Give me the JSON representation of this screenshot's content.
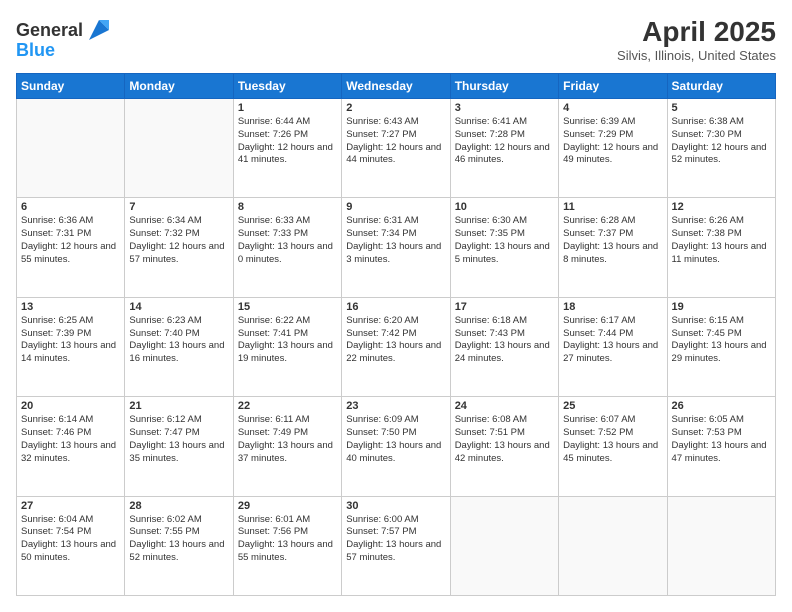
{
  "logo": {
    "line1": "General",
    "line2": "Blue"
  },
  "title": "April 2025",
  "location": "Silvis, Illinois, United States",
  "weekdays": [
    "Sunday",
    "Monday",
    "Tuesday",
    "Wednesday",
    "Thursday",
    "Friday",
    "Saturday"
  ],
  "weeks": [
    [
      {
        "day": "",
        "detail": ""
      },
      {
        "day": "",
        "detail": ""
      },
      {
        "day": "1",
        "detail": "Sunrise: 6:44 AM\nSunset: 7:26 PM\nDaylight: 12 hours and 41 minutes."
      },
      {
        "day": "2",
        "detail": "Sunrise: 6:43 AM\nSunset: 7:27 PM\nDaylight: 12 hours and 44 minutes."
      },
      {
        "day": "3",
        "detail": "Sunrise: 6:41 AM\nSunset: 7:28 PM\nDaylight: 12 hours and 46 minutes."
      },
      {
        "day": "4",
        "detail": "Sunrise: 6:39 AM\nSunset: 7:29 PM\nDaylight: 12 hours and 49 minutes."
      },
      {
        "day": "5",
        "detail": "Sunrise: 6:38 AM\nSunset: 7:30 PM\nDaylight: 12 hours and 52 minutes."
      }
    ],
    [
      {
        "day": "6",
        "detail": "Sunrise: 6:36 AM\nSunset: 7:31 PM\nDaylight: 12 hours and 55 minutes."
      },
      {
        "day": "7",
        "detail": "Sunrise: 6:34 AM\nSunset: 7:32 PM\nDaylight: 12 hours and 57 minutes."
      },
      {
        "day": "8",
        "detail": "Sunrise: 6:33 AM\nSunset: 7:33 PM\nDaylight: 13 hours and 0 minutes."
      },
      {
        "day": "9",
        "detail": "Sunrise: 6:31 AM\nSunset: 7:34 PM\nDaylight: 13 hours and 3 minutes."
      },
      {
        "day": "10",
        "detail": "Sunrise: 6:30 AM\nSunset: 7:35 PM\nDaylight: 13 hours and 5 minutes."
      },
      {
        "day": "11",
        "detail": "Sunrise: 6:28 AM\nSunset: 7:37 PM\nDaylight: 13 hours and 8 minutes."
      },
      {
        "day": "12",
        "detail": "Sunrise: 6:26 AM\nSunset: 7:38 PM\nDaylight: 13 hours and 11 minutes."
      }
    ],
    [
      {
        "day": "13",
        "detail": "Sunrise: 6:25 AM\nSunset: 7:39 PM\nDaylight: 13 hours and 14 minutes."
      },
      {
        "day": "14",
        "detail": "Sunrise: 6:23 AM\nSunset: 7:40 PM\nDaylight: 13 hours and 16 minutes."
      },
      {
        "day": "15",
        "detail": "Sunrise: 6:22 AM\nSunset: 7:41 PM\nDaylight: 13 hours and 19 minutes."
      },
      {
        "day": "16",
        "detail": "Sunrise: 6:20 AM\nSunset: 7:42 PM\nDaylight: 13 hours and 22 minutes."
      },
      {
        "day": "17",
        "detail": "Sunrise: 6:18 AM\nSunset: 7:43 PM\nDaylight: 13 hours and 24 minutes."
      },
      {
        "day": "18",
        "detail": "Sunrise: 6:17 AM\nSunset: 7:44 PM\nDaylight: 13 hours and 27 minutes."
      },
      {
        "day": "19",
        "detail": "Sunrise: 6:15 AM\nSunset: 7:45 PM\nDaylight: 13 hours and 29 minutes."
      }
    ],
    [
      {
        "day": "20",
        "detail": "Sunrise: 6:14 AM\nSunset: 7:46 PM\nDaylight: 13 hours and 32 minutes."
      },
      {
        "day": "21",
        "detail": "Sunrise: 6:12 AM\nSunset: 7:47 PM\nDaylight: 13 hours and 35 minutes."
      },
      {
        "day": "22",
        "detail": "Sunrise: 6:11 AM\nSunset: 7:49 PM\nDaylight: 13 hours and 37 minutes."
      },
      {
        "day": "23",
        "detail": "Sunrise: 6:09 AM\nSunset: 7:50 PM\nDaylight: 13 hours and 40 minutes."
      },
      {
        "day": "24",
        "detail": "Sunrise: 6:08 AM\nSunset: 7:51 PM\nDaylight: 13 hours and 42 minutes."
      },
      {
        "day": "25",
        "detail": "Sunrise: 6:07 AM\nSunset: 7:52 PM\nDaylight: 13 hours and 45 minutes."
      },
      {
        "day": "26",
        "detail": "Sunrise: 6:05 AM\nSunset: 7:53 PM\nDaylight: 13 hours and 47 minutes."
      }
    ],
    [
      {
        "day": "27",
        "detail": "Sunrise: 6:04 AM\nSunset: 7:54 PM\nDaylight: 13 hours and 50 minutes."
      },
      {
        "day": "28",
        "detail": "Sunrise: 6:02 AM\nSunset: 7:55 PM\nDaylight: 13 hours and 52 minutes."
      },
      {
        "day": "29",
        "detail": "Sunrise: 6:01 AM\nSunset: 7:56 PM\nDaylight: 13 hours and 55 minutes."
      },
      {
        "day": "30",
        "detail": "Sunrise: 6:00 AM\nSunset: 7:57 PM\nDaylight: 13 hours and 57 minutes."
      },
      {
        "day": "",
        "detail": ""
      },
      {
        "day": "",
        "detail": ""
      },
      {
        "day": "",
        "detail": ""
      }
    ]
  ]
}
